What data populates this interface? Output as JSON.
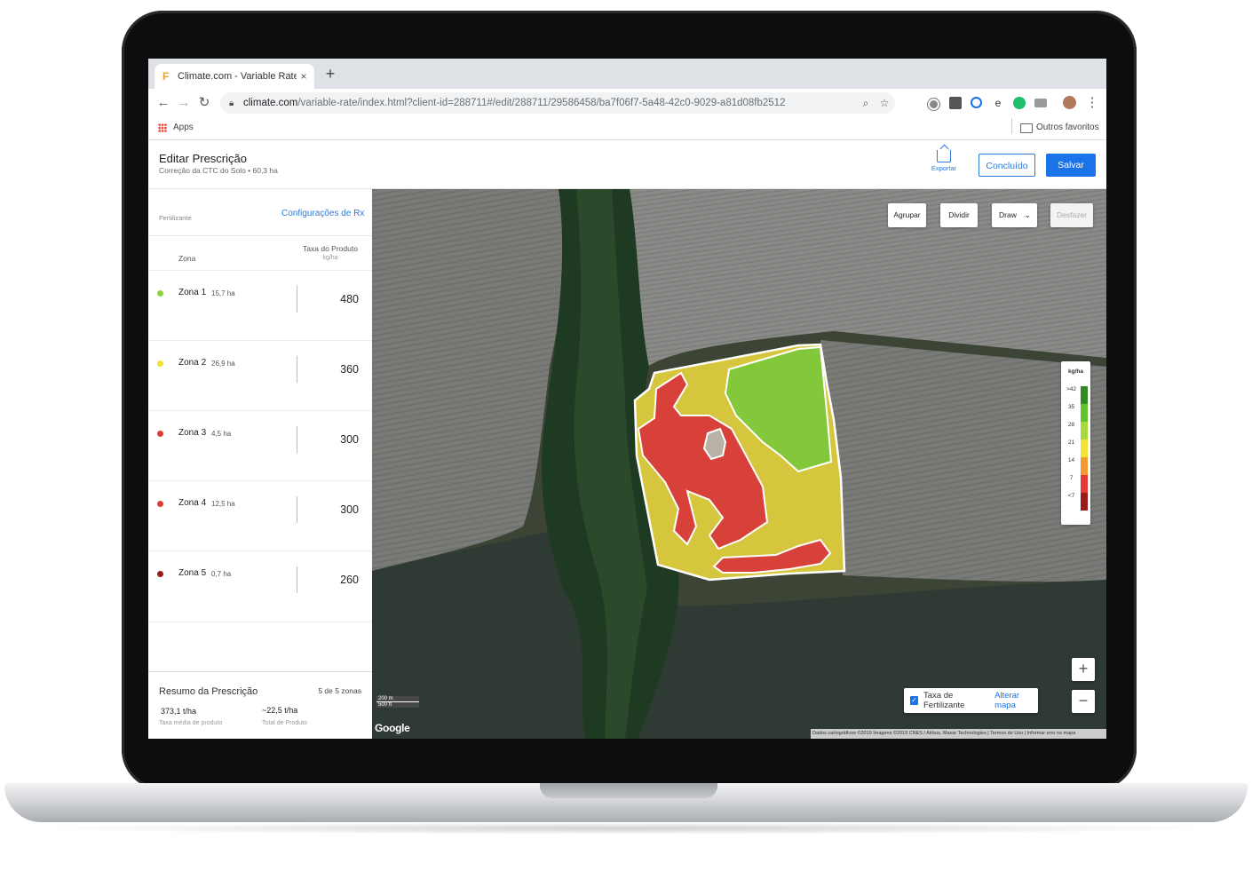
{
  "browser": {
    "tab_title": "Climate.com - Variable Rate",
    "tab_close": "×",
    "new_tab": "+",
    "url_host": "climate.com",
    "url_path": "/variable-rate/index.html?client-id=288711#/edit/288711/29586458/ba7f06f7-5a48-42c0-9029-a81d08fb2512",
    "bookmark_apps": "Apps",
    "bookmark_other": "Outros favoritos"
  },
  "header": {
    "title": "Editar Prescrição",
    "subtitle": "Correção da CTC do Solo • 60,3 ha",
    "export_label": "Exportar",
    "done_label": "Concluído",
    "save_label": "Salvar"
  },
  "panel": {
    "category": "Fertilizante",
    "config_link": "Configurações de Rx",
    "col_zone": "Zona",
    "col_rate": "Taxa do Produto",
    "col_unit": "kg/ha",
    "zones": [
      {
        "name": "Zona 1",
        "area": "15,7 ha",
        "rate": "480",
        "color": "#8bd63a"
      },
      {
        "name": "Zona 2",
        "area": "26,9 ha",
        "rate": "360",
        "color": "#f2e234"
      },
      {
        "name": "Zona 3",
        "area": "4,5 ha",
        "rate": "300",
        "color": "#e53935"
      },
      {
        "name": "Zona 4",
        "area": "12,5 ha",
        "rate": "300",
        "color": "#e53935"
      },
      {
        "name": "Zona 5",
        "area": "0,7 ha",
        "rate": "260",
        "color": "#9b1b1b"
      }
    ],
    "summary": {
      "title": "Resumo da Prescrição",
      "count": "5 de 5 zonas",
      "avg_value": "373,1 t/ha",
      "avg_label": "Taxa média de produto",
      "total_value": "~22,5 t/ha",
      "total_label": "Total de Produto"
    }
  },
  "map": {
    "tools": {
      "group": "Agrupar",
      "split": "Dividir",
      "draw": "Draw",
      "undo": "Desfazer"
    },
    "legend": {
      "title": "kg/ha",
      "labels": [
        ">42",
        "35",
        "28",
        "21",
        "14",
        "7",
        "<7"
      ],
      "colors": [
        "#2e8b1f",
        "#63c232",
        "#a6da3a",
        "#f2e234",
        "#f29a2e",
        "#e53935",
        "#9b1b1b"
      ]
    },
    "zoom_in": "+",
    "zoom_out": "−",
    "layer_checkbox": "Taxa de Fertilizante",
    "layer_link": "Alterar mapa",
    "scale_top": "200 m",
    "scale_bottom": "500 ft",
    "google": "Google",
    "attribution": "Dados cartográficos ©2019 Imagens ©2019 CNES / Airbus, Maxar Technologies | Termos de Uso | Informar erro no mapa"
  }
}
